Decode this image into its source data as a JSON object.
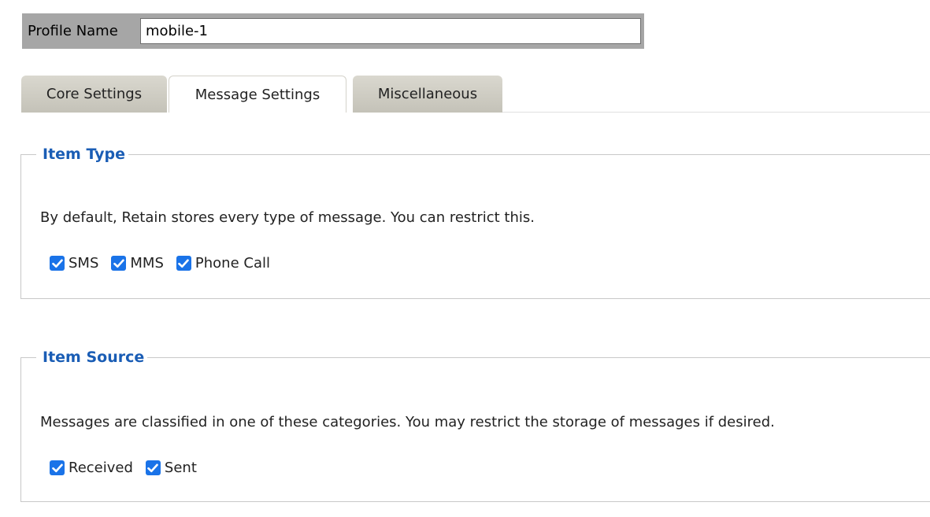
{
  "profile": {
    "label": "Profile Name",
    "value": "mobile-1"
  },
  "tabs": [
    {
      "label": "Core Settings",
      "active": false
    },
    {
      "label": "Message Settings",
      "active": true
    },
    {
      "label": "Miscellaneous",
      "active": false
    }
  ],
  "item_type": {
    "legend": "Item Type",
    "description": "By default, Retain stores every type of message. You can restrict this.",
    "options": [
      {
        "label": "SMS",
        "checked": true
      },
      {
        "label": "MMS",
        "checked": true
      },
      {
        "label": "Phone Call",
        "checked": true
      }
    ]
  },
  "item_source": {
    "legend": "Item Source",
    "description": "Messages are classified in one of these categories. You may restrict the storage of messages if desired.",
    "options": [
      {
        "label": "Received",
        "checked": true
      },
      {
        "label": "Sent",
        "checked": true
      }
    ]
  },
  "colors": {
    "accent": "#1a73e8",
    "legend_text": "#1a5db5",
    "label_background": "#a6a6a6"
  },
  "icons": {
    "checkbox": "checkmark-icon"
  }
}
